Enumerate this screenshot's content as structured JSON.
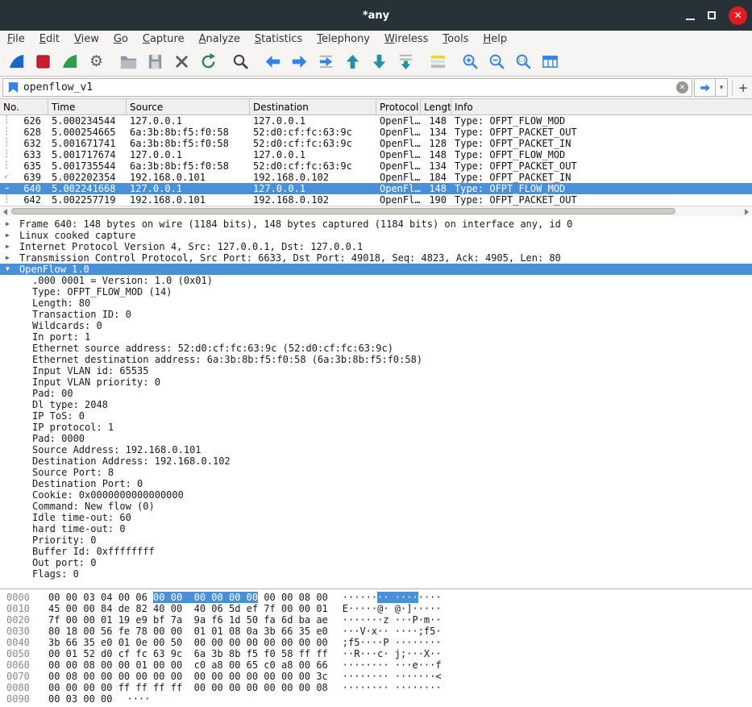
{
  "window": {
    "title": "*any"
  },
  "icons": {
    "gear": "⚙",
    "caret_down": "▾",
    "clear": "✕",
    "plus": "+",
    "close": "✕"
  },
  "menu": {
    "items": [
      "File",
      "Edit",
      "View",
      "Go",
      "Capture",
      "Analyze",
      "Statistics",
      "Telephony",
      "Wireless",
      "Tools",
      "Help"
    ]
  },
  "toolbar": {
    "icon_names": [
      "capture-start",
      "capture-stop",
      "capture-restart",
      "capture-options",
      "file-open",
      "file-save",
      "file-close",
      "reload",
      "find-packet",
      "go-back",
      "go-forward",
      "go-to-packet",
      "go-first-packet",
      "go-last-packet",
      "auto-scroll",
      "colorize-packets",
      "zoom-in",
      "zoom-out",
      "zoom-original",
      "resize-columns"
    ]
  },
  "filter": {
    "value": "openflow_v1"
  },
  "packet_list": {
    "columns": [
      "No.",
      "Time",
      "Source",
      "Destination",
      "Protocol",
      "Length",
      "Info"
    ],
    "rows": [
      {
        "mark": "┆",
        "no": "626",
        "time": "5.000234544",
        "source": "127.0.0.1",
        "destination": "127.0.0.1",
        "protocol": "OpenFl…",
        "length": "148",
        "info": "Type: OFPT_FLOW_MOD"
      },
      {
        "mark": "┆",
        "no": "628",
        "time": "5.000254665",
        "source": "6a:3b:8b:f5:f0:58",
        "destination": "52:d0:cf:fc:63:9c",
        "protocol": "OpenFl…",
        "length": "134",
        "info": "Type: OFPT_PACKET_OUT"
      },
      {
        "mark": "┆",
        "no": "632",
        "time": "5.001671741",
        "source": "6a:3b:8b:f5:f0:58",
        "destination": "52:d0:cf:fc:63:9c",
        "protocol": "OpenFl…",
        "length": "128",
        "info": "Type: OFPT_PACKET_IN"
      },
      {
        "mark": "┆",
        "no": "633",
        "time": "5.001717674",
        "source": "127.0.0.1",
        "destination": "127.0.0.1",
        "protocol": "OpenFl…",
        "length": "148",
        "info": "Type: OFPT_FLOW_MOD"
      },
      {
        "mark": "┆",
        "no": "635",
        "time": "5.001735544",
        "source": "6a:3b:8b:f5:f0:58",
        "destination": "52:d0:cf:fc:63:9c",
        "protocol": "OpenFl…",
        "length": "134",
        "info": "Type: OFPT_PACKET_OUT"
      },
      {
        "mark": "✓",
        "no": "639",
        "time": "5.002202354",
        "source": "192.168.0.101",
        "destination": "192.168.0.102",
        "protocol": "OpenFl…",
        "length": "184",
        "info": "Type: OFPT_PACKET_IN"
      },
      {
        "mark": "→",
        "no": "640",
        "time": "5.002241668",
        "source": "127.0.0.1",
        "destination": "127.0.0.1",
        "protocol": "OpenFl…",
        "length": "148",
        "info": "Type: OFPT_FLOW_MOD",
        "selected": true
      },
      {
        "mark": "┆",
        "no": "642",
        "time": "5.002257719",
        "source": "192.168.0.101",
        "destination": "192.168.0.102",
        "protocol": "OpenFl…",
        "length": "190",
        "info": "Type: OFPT_PACKET_OUT"
      }
    ]
  },
  "details": {
    "lines": [
      {
        "caret": "▶",
        "text": "Frame 640: 148 bytes on wire (1184 bits), 148 bytes captured (1184 bits) on interface any, id 0"
      },
      {
        "caret": "▶",
        "text": "Linux cooked capture"
      },
      {
        "caret": "▶",
        "text": "Internet Protocol Version 4, Src: 127.0.0.1, Dst: 127.0.0.1"
      },
      {
        "caret": "▶",
        "text": "Transmission Control Protocol, Src Port: 6633, Dst Port: 49018, Seq: 4823, Ack: 4905, Len: 80"
      },
      {
        "caret": "▼",
        "text": "OpenFlow 1.0",
        "selected": true
      },
      {
        "caret": "",
        "child": true,
        "text": ".000 0001 = Version: 1.0 (0x01)"
      },
      {
        "caret": "",
        "child": true,
        "text": "Type: OFPT_FLOW_MOD (14)"
      },
      {
        "caret": "",
        "child": true,
        "text": "Length: 80"
      },
      {
        "caret": "",
        "child": true,
        "text": "Transaction ID: 0"
      },
      {
        "caret": "",
        "child": true,
        "text": "Wildcards: 0"
      },
      {
        "caret": "",
        "child": true,
        "text": "In port: 1"
      },
      {
        "caret": "",
        "child": true,
        "text": "Ethernet source address: 52:d0:cf:fc:63:9c (52:d0:cf:fc:63:9c)"
      },
      {
        "caret": "",
        "child": true,
        "text": "Ethernet destination address: 6a:3b:8b:f5:f0:58 (6a:3b:8b:f5:f0:58)"
      },
      {
        "caret": "",
        "child": true,
        "text": "Input VLAN id: 65535"
      },
      {
        "caret": "",
        "child": true,
        "text": "Input VLAN priority: 0"
      },
      {
        "caret": "",
        "child": true,
        "text": "Pad: 00"
      },
      {
        "caret": "",
        "child": true,
        "text": "Dl type: 2048"
      },
      {
        "caret": "",
        "child": true,
        "text": "IP ToS: 0"
      },
      {
        "caret": "",
        "child": true,
        "text": "IP protocol: 1"
      },
      {
        "caret": "",
        "child": true,
        "text": "Pad: 0000"
      },
      {
        "caret": "",
        "child": true,
        "text": "Source Address: 192.168.0.101"
      },
      {
        "caret": "",
        "child": true,
        "text": "Destination Address: 192.168.0.102"
      },
      {
        "caret": "",
        "child": true,
        "text": "Source Port: 8"
      },
      {
        "caret": "",
        "child": true,
        "text": "Destination Port: 0"
      },
      {
        "caret": "",
        "child": true,
        "text": "Cookie: 0x0000000000000000"
      },
      {
        "caret": "",
        "child": true,
        "text": "Command: New flow (0)"
      },
      {
        "caret": "",
        "child": true,
        "text": "Idle time-out: 60"
      },
      {
        "caret": "",
        "child": true,
        "text": "hard time-out: 0"
      },
      {
        "caret": "",
        "child": true,
        "text": "Priority: 0"
      },
      {
        "caret": "",
        "child": true,
        "text": "Buffer Id: 0xffffffff"
      },
      {
        "caret": "",
        "child": true,
        "text": "Out port: 0"
      },
      {
        "caret": "",
        "child": true,
        "text": "Flags: 0"
      }
    ]
  },
  "hex": {
    "rows": [
      {
        "offset": "0000",
        "pre": "00 00 03 04 00 06 ",
        "hl": "00 00  00 00 00 00",
        "post": " 00 00 08 00",
        "apre": "······",
        "ahl": "·· ····",
        "apost": "····"
      },
      {
        "offset": "0010",
        "pre": "45 00 00 84 de 82 40 00  40 06 5d ef 7f 00 00 01",
        "hl": "",
        "post": "",
        "apre": "E·····@· @·]·····",
        "ahl": "",
        "apost": ""
      },
      {
        "offset": "0020",
        "pre": "7f 00 00 01 19 e9 bf 7a  9a f6 1d 50 fa 6d ba ae",
        "hl": "",
        "post": "",
        "apre": "·······z ···P·m··",
        "ahl": "",
        "apost": ""
      },
      {
        "offset": "0030",
        "pre": "80 18 00 56 fe 78 00 00  01 01 08 0a 3b 66 35 e0",
        "hl": "",
        "post": "",
        "apre": "···V·x·· ····;f5·",
        "ahl": "",
        "apost": ""
      },
      {
        "offset": "0040",
        "pre": "3b 66 35 e0 01 0e 00 50  00 00 00 00 00 00 00 00",
        "hl": "",
        "post": "",
        "apre": ";f5····P ········",
        "ahl": "",
        "apost": ""
      },
      {
        "offset": "0050",
        "pre": "00 01 52 d0 cf fc 63 9c  6a 3b 8b f5 f0 58 ff ff",
        "hl": "",
        "post": "",
        "apre": "··R···c· j;···X··",
        "ahl": "",
        "apost": ""
      },
      {
        "offset": "0060",
        "pre": "00 00 08 00 00 01 00 00  c0 a8 00 65 c0 a8 00 66",
        "hl": "",
        "post": "",
        "apre": "········ ···e···f",
        "ahl": "",
        "apost": ""
      },
      {
        "offset": "0070",
        "pre": "00 08 00 00 00 00 00 00  00 00 00 00 00 00 00 3c",
        "hl": "",
        "post": "",
        "apre": "········ ·······<",
        "ahl": "",
        "apost": ""
      },
      {
        "offset": "0080",
        "pre": "00 00 00 00 ff ff ff ff  00 00 00 00 00 00 00 08",
        "hl": "",
        "post": "",
        "apre": "········ ········",
        "ahl": "",
        "apost": ""
      },
      {
        "offset": "0090",
        "pre": "00 03 00 00",
        "hl": "",
        "post": "",
        "apre": "····",
        "ahl": "",
        "apost": ""
      }
    ]
  }
}
